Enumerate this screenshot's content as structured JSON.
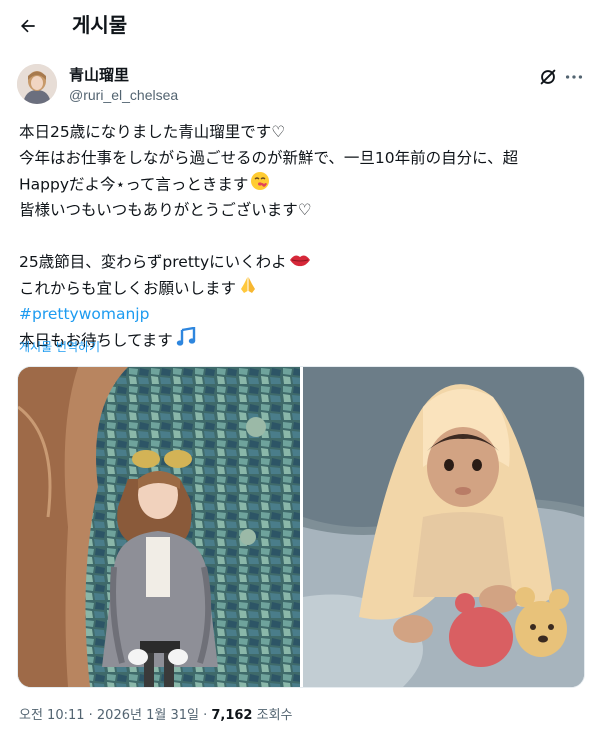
{
  "header": {
    "title": "게시물"
  },
  "post": {
    "author_name": "青山瑠里",
    "author_handle": "@ruri_el_chelsea",
    "lines": [
      "本日25歳になりました青山瑠里です♡",
      "今年はお仕事をしながら過ごせるのが新鮮で、一旦10年前の自分に、超",
      "Happyだよ今⋆って言っときます",
      "皆様いつもいつもありがとうございます♡",
      "",
      "25歳節目、変わらずprettyにいくわよ",
      "これからも宜しくお願いします"
    ],
    "hashtag": "#prettywomanjp",
    "last_line": " 本日もお待ちしてます",
    "translate": "게시물 번역하기",
    "time": "오전 10:11 · 2026년 1월 31일 · ",
    "views": "7,162",
    "views_label": " 조회수"
  },
  "colors": {
    "link": "#1d9bf0",
    "secondary": "#536471",
    "text": "#0f1419"
  },
  "icons": [
    "back-arrow-icon",
    "grok-icon",
    "more-icon",
    "kiss-emoji-icon",
    "lips-emoji-icon",
    "praying-hands-emoji-icon",
    "music-notes-emoji-icon"
  ]
}
